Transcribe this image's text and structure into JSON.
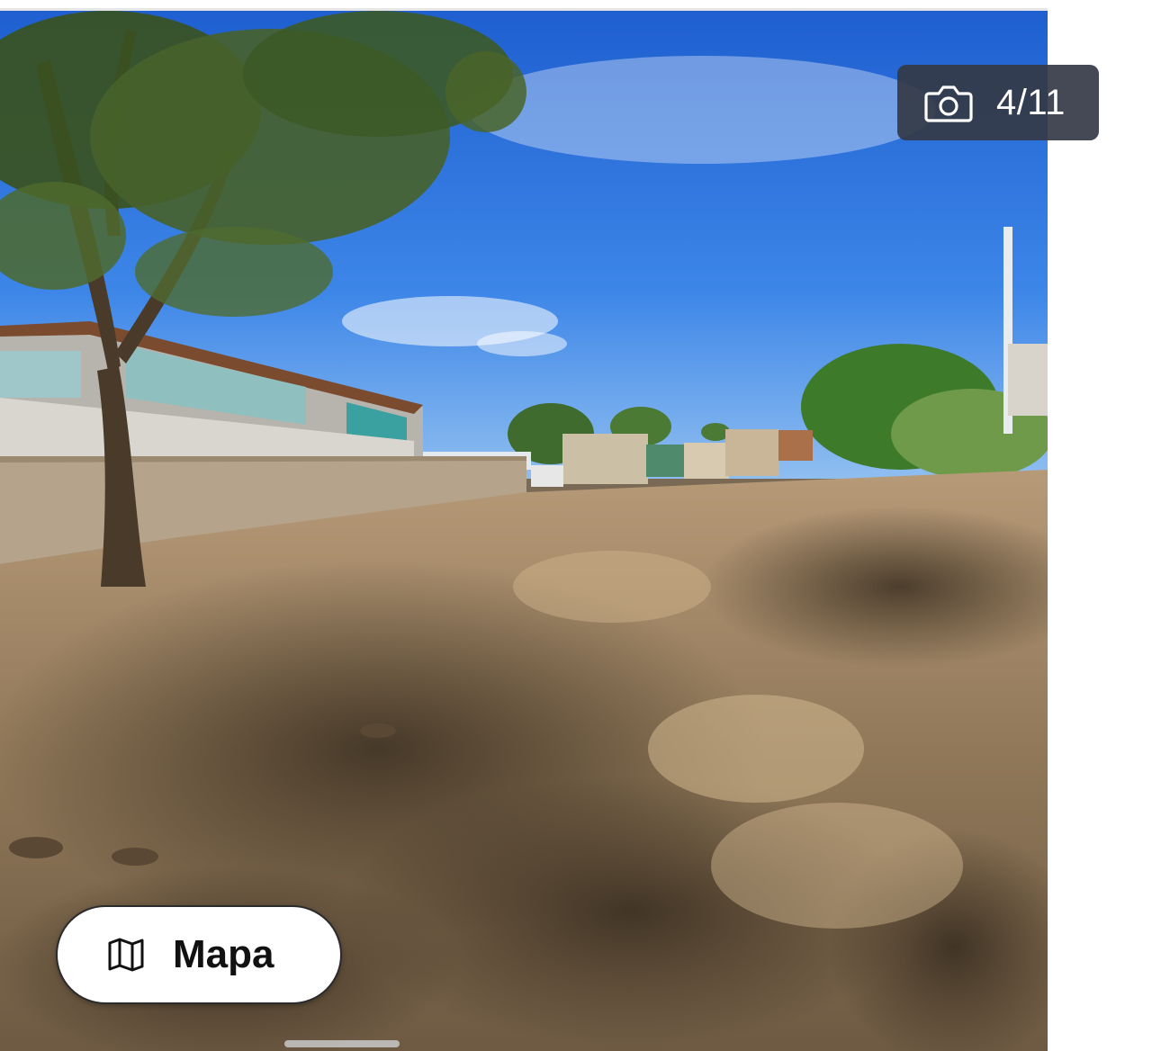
{
  "gallery": {
    "counter_text": "4/11",
    "counter_icon": "camera-icon",
    "map_button_label": "Mapa",
    "map_button_icon": "map-icon"
  },
  "colors": {
    "badge_background": "#343a46",
    "map_button_background": "#ffffff",
    "sky": "#2f6fd6",
    "ground": "#9c8366"
  }
}
